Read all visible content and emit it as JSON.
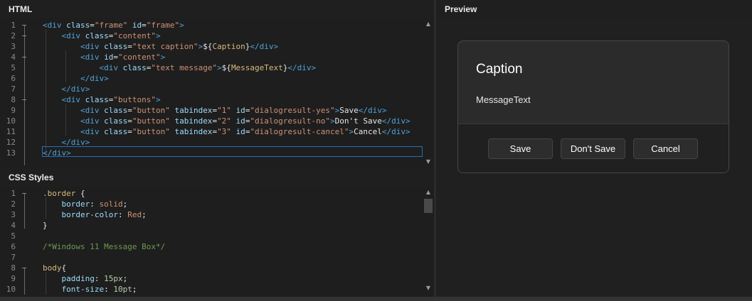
{
  "html_pane": {
    "title": "HTML",
    "lines": [
      {
        "n": "1",
        "fold": "−",
        "segs": [
          {
            "t": "<div ",
            "c": "tag"
          },
          {
            "t": "class",
            "c": "attr"
          },
          {
            "t": "=",
            "c": "txt"
          },
          {
            "t": "\"frame\"",
            "c": "val"
          },
          {
            "t": " ",
            "c": "txt"
          },
          {
            "t": "id",
            "c": "attr"
          },
          {
            "t": "=",
            "c": "txt"
          },
          {
            "t": "\"frame\"",
            "c": "val"
          },
          {
            "t": ">",
            "c": "tag"
          }
        ]
      },
      {
        "n": "2",
        "fold": "−",
        "segs": [
          {
            "t": "    <div ",
            "c": "tag"
          },
          {
            "t": "class",
            "c": "attr"
          },
          {
            "t": "=",
            "c": "txt"
          },
          {
            "t": "\"content\"",
            "c": "val"
          },
          {
            "t": ">",
            "c": "tag"
          }
        ]
      },
      {
        "n": "3",
        "fold": "",
        "segs": [
          {
            "t": "        <div ",
            "c": "tag"
          },
          {
            "t": "class",
            "c": "attr"
          },
          {
            "t": "=",
            "c": "txt"
          },
          {
            "t": "\"text caption\"",
            "c": "val"
          },
          {
            "t": ">",
            "c": "tag"
          },
          {
            "t": "${",
            "c": "txt"
          },
          {
            "t": "Caption",
            "c": "tpl"
          },
          {
            "t": "}",
            "c": "txt"
          },
          {
            "t": "</div>",
            "c": "tag"
          }
        ]
      },
      {
        "n": "4",
        "fold": "−",
        "segs": [
          {
            "t": "        <div ",
            "c": "tag"
          },
          {
            "t": "id",
            "c": "attr"
          },
          {
            "t": "=",
            "c": "txt"
          },
          {
            "t": "\"content\"",
            "c": "val"
          },
          {
            "t": ">",
            "c": "tag"
          }
        ]
      },
      {
        "n": "5",
        "fold": "",
        "segs": [
          {
            "t": "            <div ",
            "c": "tag"
          },
          {
            "t": "class",
            "c": "attr"
          },
          {
            "t": "=",
            "c": "txt"
          },
          {
            "t": "\"text message\"",
            "c": "val"
          },
          {
            "t": ">",
            "c": "tag"
          },
          {
            "t": "${",
            "c": "txt"
          },
          {
            "t": "MessageText",
            "c": "tpl"
          },
          {
            "t": "}",
            "c": "txt"
          },
          {
            "t": "</div>",
            "c": "tag"
          }
        ]
      },
      {
        "n": "6",
        "fold": "",
        "segs": [
          {
            "t": "        </div>",
            "c": "tag"
          }
        ]
      },
      {
        "n": "7",
        "fold": "",
        "segs": [
          {
            "t": "    </div>",
            "c": "tag"
          }
        ]
      },
      {
        "n": "8",
        "fold": "−",
        "segs": [
          {
            "t": "    <div ",
            "c": "tag"
          },
          {
            "t": "class",
            "c": "attr"
          },
          {
            "t": "=",
            "c": "txt"
          },
          {
            "t": "\"buttons\"",
            "c": "val"
          },
          {
            "t": ">",
            "c": "tag"
          }
        ]
      },
      {
        "n": "9",
        "fold": "",
        "segs": [
          {
            "t": "        <div ",
            "c": "tag"
          },
          {
            "t": "class",
            "c": "attr"
          },
          {
            "t": "=",
            "c": "txt"
          },
          {
            "t": "\"button\"",
            "c": "val"
          },
          {
            "t": " ",
            "c": "txt"
          },
          {
            "t": "tabindex",
            "c": "attr"
          },
          {
            "t": "=",
            "c": "txt"
          },
          {
            "t": "\"1\"",
            "c": "val"
          },
          {
            "t": " ",
            "c": "txt"
          },
          {
            "t": "id",
            "c": "attr"
          },
          {
            "t": "=",
            "c": "txt"
          },
          {
            "t": "\"dialogresult-yes\"",
            "c": "val"
          },
          {
            "t": ">",
            "c": "tag"
          },
          {
            "t": "Save",
            "c": "txt"
          },
          {
            "t": "</div>",
            "c": "tag"
          }
        ]
      },
      {
        "n": "10",
        "fold": "",
        "segs": [
          {
            "t": "        <div ",
            "c": "tag"
          },
          {
            "t": "class",
            "c": "attr"
          },
          {
            "t": "=",
            "c": "txt"
          },
          {
            "t": "\"button\"",
            "c": "val"
          },
          {
            "t": " ",
            "c": "txt"
          },
          {
            "t": "tabindex",
            "c": "attr"
          },
          {
            "t": "=",
            "c": "txt"
          },
          {
            "t": "\"2\"",
            "c": "val"
          },
          {
            "t": " ",
            "c": "txt"
          },
          {
            "t": "id",
            "c": "attr"
          },
          {
            "t": "=",
            "c": "txt"
          },
          {
            "t": "\"dialogresult-no\"",
            "c": "val"
          },
          {
            "t": ">",
            "c": "tag"
          },
          {
            "t": "Don't Save",
            "c": "txt"
          },
          {
            "t": "</div>",
            "c": "tag"
          }
        ]
      },
      {
        "n": "11",
        "fold": "",
        "segs": [
          {
            "t": "        <div ",
            "c": "tag"
          },
          {
            "t": "class",
            "c": "attr"
          },
          {
            "t": "=",
            "c": "txt"
          },
          {
            "t": "\"button\"",
            "c": "val"
          },
          {
            "t": " ",
            "c": "txt"
          },
          {
            "t": "tabindex",
            "c": "attr"
          },
          {
            "t": "=",
            "c": "txt"
          },
          {
            "t": "\"3\"",
            "c": "val"
          },
          {
            "t": " ",
            "c": "txt"
          },
          {
            "t": "id",
            "c": "attr"
          },
          {
            "t": "=",
            "c": "txt"
          },
          {
            "t": "\"dialogresult-cancel\"",
            "c": "val"
          },
          {
            "t": ">",
            "c": "tag"
          },
          {
            "t": "Cancel",
            "c": "txt"
          },
          {
            "t": "</div>",
            "c": "tag"
          }
        ]
      },
      {
        "n": "12",
        "fold": "",
        "segs": [
          {
            "t": "    </div>",
            "c": "tag"
          }
        ]
      },
      {
        "n": "13",
        "fold": "",
        "segs": [
          {
            "t": "</div>",
            "c": "tag"
          }
        ]
      }
    ]
  },
  "css_pane": {
    "title": "CSS Styles",
    "lines": [
      {
        "n": "1",
        "fold": "−",
        "segs": [
          {
            "t": ".border",
            "c": "sel"
          },
          {
            "t": " {",
            "c": "txt"
          }
        ]
      },
      {
        "n": "2",
        "fold": "",
        "segs": [
          {
            "t": "    border",
            "c": "prop"
          },
          {
            "t": ": ",
            "c": "txt"
          },
          {
            "t": "solid",
            "c": "kw"
          },
          {
            "t": ";",
            "c": "txt"
          }
        ]
      },
      {
        "n": "3",
        "fold": "",
        "segs": [
          {
            "t": "    border-color",
            "c": "prop"
          },
          {
            "t": ": ",
            "c": "txt"
          },
          {
            "t": "Red",
            "c": "kw"
          },
          {
            "t": ";",
            "c": "txt"
          }
        ]
      },
      {
        "n": "4",
        "fold": "",
        "segs": [
          {
            "t": "}",
            "c": "txt"
          }
        ]
      },
      {
        "n": "5",
        "fold": "",
        "segs": []
      },
      {
        "n": "6",
        "fold": "",
        "segs": [
          {
            "t": "/*Windows 11 Message Box*/",
            "c": "cmt"
          }
        ]
      },
      {
        "n": "7",
        "fold": "",
        "segs": []
      },
      {
        "n": "8",
        "fold": "−",
        "segs": [
          {
            "t": "body",
            "c": "sel"
          },
          {
            "t": "{",
            "c": "txt"
          }
        ]
      },
      {
        "n": "9",
        "fold": "",
        "segs": [
          {
            "t": "    padding",
            "c": "prop"
          },
          {
            "t": ": ",
            "c": "txt"
          },
          {
            "t": "15px",
            "c": "num"
          },
          {
            "t": ";",
            "c": "txt"
          }
        ]
      },
      {
        "n": "10",
        "fold": "",
        "segs": [
          {
            "t": "    font-size",
            "c": "prop"
          },
          {
            "t": ": ",
            "c": "txt"
          },
          {
            "t": "10pt",
            "c": "num"
          },
          {
            "t": ";",
            "c": "txt"
          }
        ]
      }
    ]
  },
  "preview_pane": {
    "title": "Preview",
    "dialog": {
      "caption": "Caption",
      "message": "MessageText",
      "buttons": [
        "Save",
        "Don't Save",
        "Cancel"
      ]
    }
  },
  "icons": {
    "scroll_up": "triangle-up-icon",
    "scroll_down": "triangle-down-icon"
  }
}
